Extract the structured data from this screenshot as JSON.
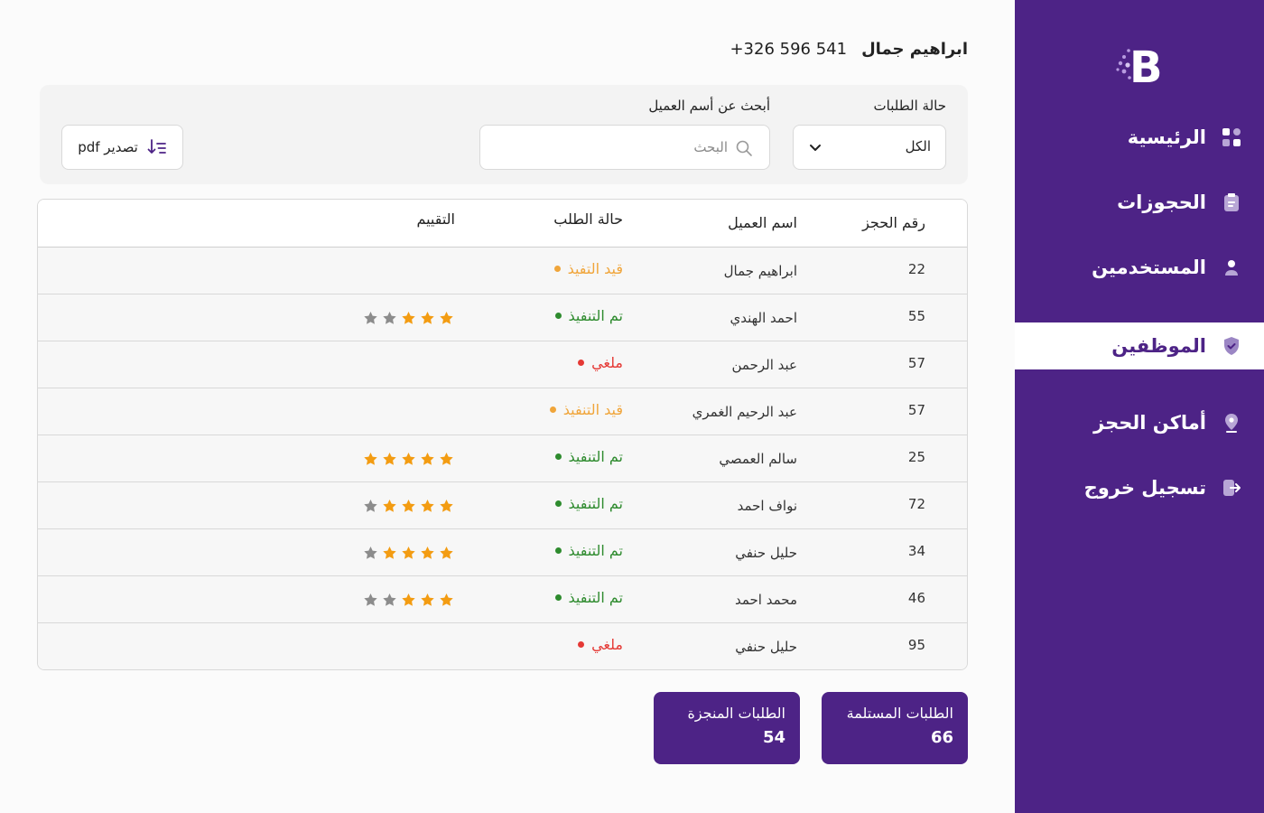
{
  "header": {
    "user_name": "ابراهيم جمال",
    "phone": "+326 596 541"
  },
  "sidebar": {
    "logo_letter": "B",
    "items": [
      {
        "label": "الرئيسية",
        "icon": "grid-icon",
        "active": false
      },
      {
        "label": "الحجوزات",
        "icon": "clipboard-icon",
        "active": false
      },
      {
        "label": "المستخدمين",
        "icon": "user-icon",
        "active": false
      },
      {
        "label": "الموظفين",
        "icon": "shield-icon",
        "active": true
      },
      {
        "label": "أماكن الحجز",
        "icon": "location-pin-icon",
        "active": false
      },
      {
        "label": "تسجيل خروج",
        "icon": "logout-icon",
        "active": false
      }
    ]
  },
  "filters": {
    "status_label": "حالة الطلبات",
    "status_value": "الكل",
    "search_label": "أبحث عن أسم العميل",
    "search_placeholder": "البحث",
    "export_label": "تصدير pdf"
  },
  "table": {
    "headers": {
      "id": "رقم الحجز",
      "name": "اسم العميل",
      "status": "حالة الطلب",
      "rating": "التقييم"
    },
    "rows": [
      {
        "id": "22",
        "name": "ابراهيم جمال",
        "status": "قيد التفيذ",
        "status_type": "pending",
        "rating": null
      },
      {
        "id": "55",
        "name": "احمد الهندي",
        "status": "تم التنفيذ",
        "status_type": "done",
        "rating": 3
      },
      {
        "id": "57",
        "name": "عبد الرحمن",
        "status": "ملغي",
        "status_type": "cancelled",
        "rating": null
      },
      {
        "id": "57",
        "name": "عبد الرحيم الغمري",
        "status": "قيد التنفيذ",
        "status_type": "pending",
        "rating": null
      },
      {
        "id": "25",
        "name": "سالم العمصي",
        "status": "تم التنفيذ",
        "status_type": "done",
        "rating": 5
      },
      {
        "id": "72",
        "name": "نواف احمد",
        "status": "تم التنفيذ",
        "status_type": "done",
        "rating": 4
      },
      {
        "id": "34",
        "name": "حليل حنفي",
        "status": "تم التنفيذ",
        "status_type": "done",
        "rating": 4
      },
      {
        "id": "46",
        "name": "محمد احمد",
        "status": "تم التنفيذ",
        "status_type": "done",
        "rating": 3
      },
      {
        "id": "95",
        "name": "حليل حنفي",
        "status": "ملغي",
        "status_type": "cancelled",
        "rating": null
      }
    ]
  },
  "stats": {
    "received": {
      "label": "الطلبات المستلمة",
      "value": "66"
    },
    "completed": {
      "label": "الطلبات المنجزة",
      "value": "54"
    }
  },
  "colors": {
    "brand": "#4d2386",
    "status_pending": "#f0a53a",
    "status_done": "#2e8b2e",
    "status_cancelled": "#e53935",
    "star_filled": "#f39c12",
    "star_empty": "#8c8c8c"
  }
}
